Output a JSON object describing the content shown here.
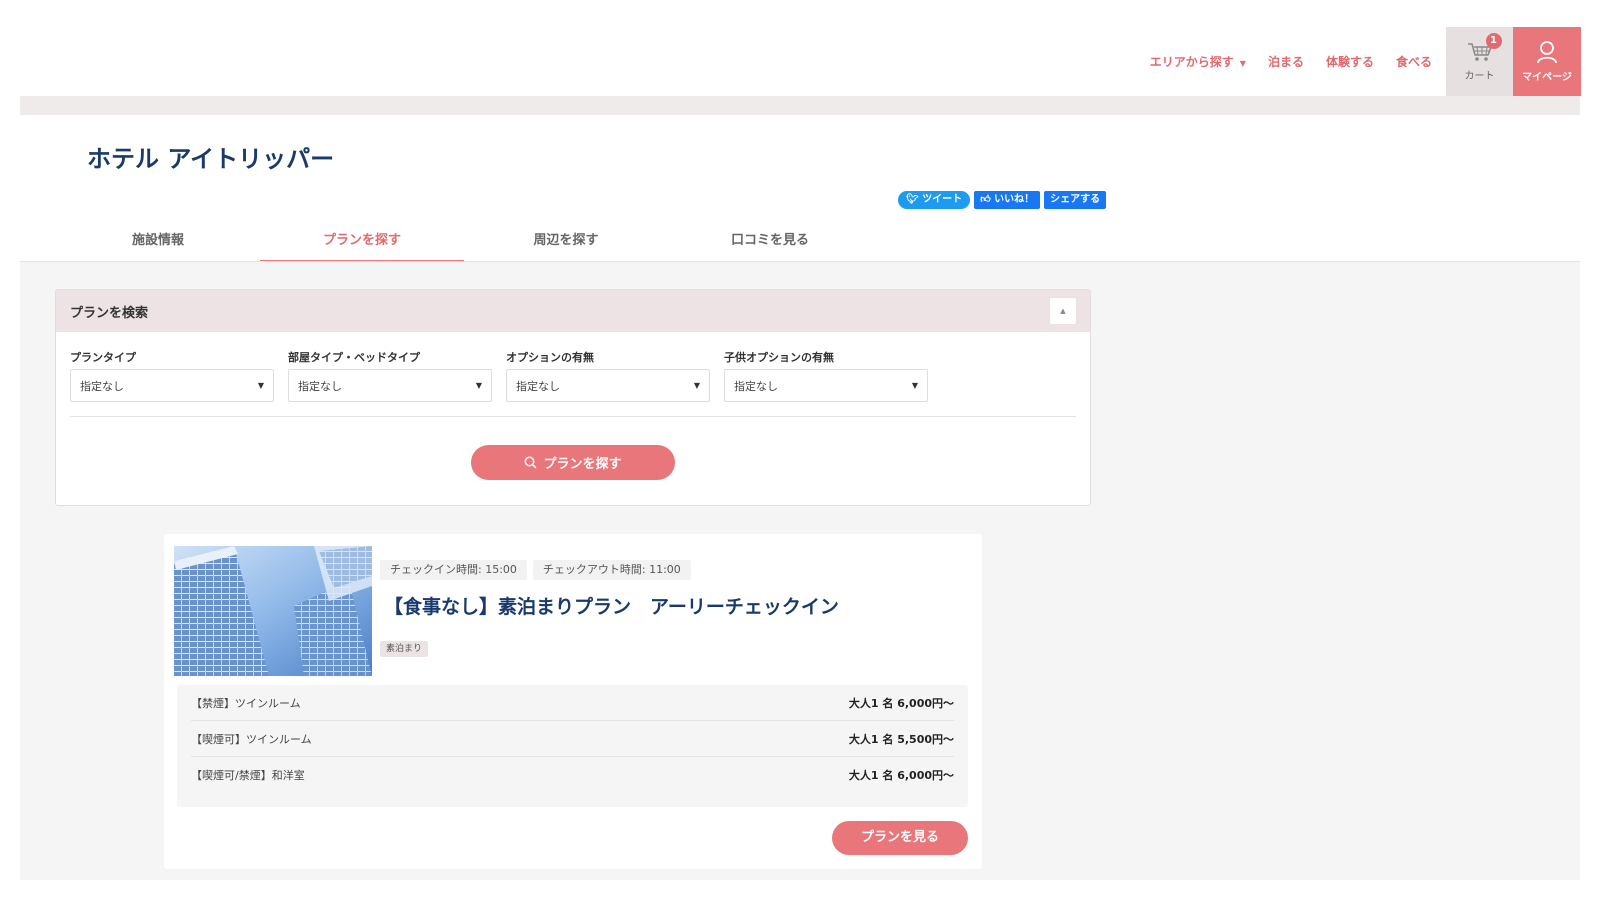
{
  "header": {
    "nav": [
      {
        "label": "エリアから探す",
        "has_caret": true
      },
      {
        "label": "泊まる"
      },
      {
        "label": "体験する"
      },
      {
        "label": "食べる"
      }
    ],
    "cart_label": "カート",
    "cart_count": "1",
    "mypage_label": "マイページ"
  },
  "hotel": {
    "title": "ホテル アイトリッパー"
  },
  "social": {
    "tweet": "ツイート",
    "like": "いいね！",
    "share": "シェアする"
  },
  "tabs": [
    {
      "label": "施設情報"
    },
    {
      "label": "プランを探す"
    },
    {
      "label": "周辺を探す"
    },
    {
      "label": "口コミを見る"
    }
  ],
  "search": {
    "title": "プランを検索",
    "filters": [
      {
        "label": "プランタイプ",
        "value": "指定なし"
      },
      {
        "label": "部屋タイプ・ベッドタイプ",
        "value": "指定なし"
      },
      {
        "label": "オプションの有無",
        "value": "指定なし"
      },
      {
        "label": "子供オプションの有無",
        "value": "指定なし"
      }
    ],
    "button": "プランを探す"
  },
  "plan": {
    "checkin": "チェックイン時間: 15:00",
    "checkout": "チェックアウト時間: 11:00",
    "title": "【食事なし】素泊まりプラン　アーリーチェックイン",
    "meal_badge": "素泊まり",
    "rooms": [
      {
        "name": "【禁煙】ツインルーム",
        "price": "大人1 名 6,000円～"
      },
      {
        "name": "【喫煙可】ツインルーム",
        "price": "大人1 名 5,500円～"
      },
      {
        "name": "【喫煙可/禁煙】和洋室",
        "price": "大人1 名 6,000円～"
      }
    ],
    "button": "プランを見る"
  },
  "colors": {
    "accent": "#e8767b",
    "title": "#1a3a6b",
    "twitter": "#1d9bf0",
    "facebook": "#1877f2"
  }
}
